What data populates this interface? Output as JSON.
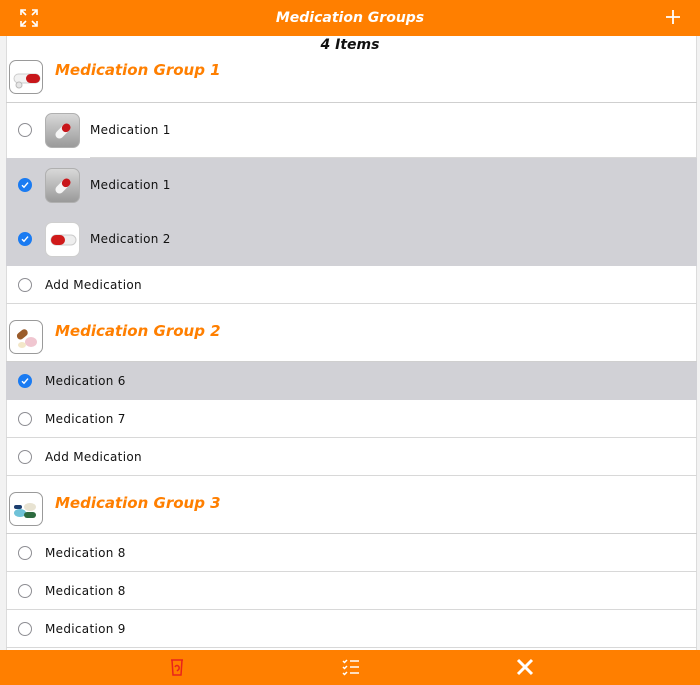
{
  "header": {
    "title": "Medication Groups"
  },
  "count_text": "4 Items",
  "groups": [
    {
      "title": "Medication Group 1",
      "rows": [
        {
          "label": "Medication 1",
          "checked": false,
          "thumb": "capsule-grey"
        },
        {
          "label": "Medication 1",
          "checked": true,
          "thumb": "capsule-grey"
        },
        {
          "label": "Medication 2",
          "checked": true,
          "thumb": "capsule-red"
        },
        {
          "label": "Add Medication",
          "checked": false
        }
      ]
    },
    {
      "title": "Medication Group 2",
      "rows": [
        {
          "label": "Medication 6",
          "checked": true
        },
        {
          "label": "Medication 7",
          "checked": false
        },
        {
          "label": "Add Medication",
          "checked": false
        }
      ]
    },
    {
      "title": "Medication Group 3",
      "rows": [
        {
          "label": "Medication 8",
          "checked": false
        },
        {
          "label": "Medication 8",
          "checked": false
        },
        {
          "label": "Medication 9",
          "checked": false
        }
      ]
    }
  ],
  "colors": {
    "accent": "#ff7f00",
    "selected_row": "#d1d1d6",
    "check": "#1a7bf2",
    "icon_red": "#e8231c"
  },
  "icons": {
    "top_left": "expand-icon",
    "top_right": "plus-icon",
    "bottom": [
      "trash-icon",
      "checklist-icon",
      "close-icon"
    ]
  }
}
